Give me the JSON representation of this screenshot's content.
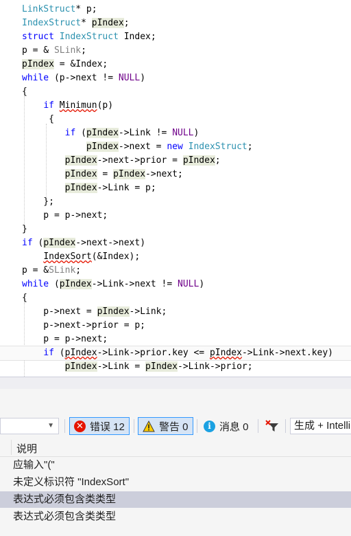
{
  "editor": {
    "lines": [
      [
        [
          "LinkStruct",
          "type"
        ],
        [
          "* p;",
          ""
        ]
      ],
      [
        [
          "IndexStruct",
          "type"
        ],
        [
          "* ",
          ""
        ],
        [
          "pIndex",
          "hl"
        ],
        [
          ";",
          ""
        ]
      ],
      [
        [
          "struct ",
          "kw"
        ],
        [
          "IndexStruct",
          "type"
        ],
        [
          " Index;",
          ""
        ]
      ],
      [
        [
          "p = & ",
          ""
        ],
        [
          "SLink",
          "dim"
        ],
        [
          ";",
          ""
        ]
      ],
      [
        [
          "pIndex",
          "hl"
        ],
        [
          " = &Index;",
          ""
        ]
      ],
      [
        [
          "while",
          "kw"
        ],
        [
          " (p->next != ",
          ""
        ],
        [
          "NULL",
          "macro"
        ],
        [
          ")",
          ""
        ]
      ],
      [
        [
          "{",
          ""
        ]
      ],
      [
        [
          "    ",
          ""
        ],
        [
          "if",
          "kw"
        ],
        [
          " ",
          ""
        ],
        [
          "Minimun",
          "err"
        ],
        [
          "(p)",
          ""
        ]
      ],
      [
        [
          "     {",
          ""
        ]
      ],
      [
        [
          "        ",
          ""
        ],
        [
          "if",
          "kw"
        ],
        [
          " (",
          ""
        ],
        [
          "pIndex",
          "hl"
        ],
        [
          "->Link != ",
          ""
        ],
        [
          "NULL",
          "macro"
        ],
        [
          ")",
          ""
        ]
      ],
      [
        [
          "            ",
          ""
        ],
        [
          "pIndex",
          "hl"
        ],
        [
          "->next = ",
          ""
        ],
        [
          "new",
          "kw"
        ],
        [
          " ",
          ""
        ],
        [
          "IndexStruct",
          "type"
        ],
        [
          ";",
          ""
        ]
      ],
      [
        [
          "        ",
          ""
        ],
        [
          "pIndex",
          "hl"
        ],
        [
          "->next->prior = ",
          ""
        ],
        [
          "pIndex",
          "hl"
        ],
        [
          ";",
          ""
        ]
      ],
      [
        [
          "        ",
          ""
        ],
        [
          "pIndex",
          "hl"
        ],
        [
          " = ",
          ""
        ],
        [
          "pIndex",
          "hl"
        ],
        [
          "->next;",
          ""
        ]
      ],
      [
        [
          "        ",
          ""
        ],
        [
          "pIndex",
          "hl"
        ],
        [
          "->Link = p;",
          ""
        ]
      ],
      [
        [
          "    };",
          ""
        ]
      ],
      [
        [
          "    p = p->next;",
          ""
        ]
      ],
      [
        [
          "}",
          ""
        ]
      ],
      [
        [
          "if",
          "kw"
        ],
        [
          " (",
          ""
        ],
        [
          "pIndex",
          "hl"
        ],
        [
          "->next->next)",
          ""
        ]
      ],
      [
        [
          "    ",
          ""
        ],
        [
          "IndexSort",
          "err"
        ],
        [
          "(&Index);",
          ""
        ]
      ],
      [
        [
          "p = &",
          ""
        ],
        [
          "SLink",
          "dim"
        ],
        [
          ";",
          ""
        ]
      ],
      [
        [
          "while",
          "kw"
        ],
        [
          " (",
          ""
        ],
        [
          "pIndex",
          "hl"
        ],
        [
          "->Link->next != ",
          ""
        ],
        [
          "NULL",
          "macro"
        ],
        [
          ")",
          ""
        ]
      ],
      [
        [
          "{",
          ""
        ]
      ],
      [
        [
          "    p->next = ",
          ""
        ],
        [
          "pIndex",
          "hl"
        ],
        [
          "->Link;",
          ""
        ]
      ],
      [
        [
          "    p->next->prior = p;",
          ""
        ]
      ],
      [
        [
          "    p = p->next;",
          ""
        ]
      ],
      [
        [
          "    ",
          ""
        ],
        [
          "if",
          "kw"
        ],
        [
          " (",
          ""
        ],
        [
          "pIndex",
          "err"
        ],
        [
          "->Link->prior.key <= ",
          ""
        ],
        [
          "pIndex",
          "err"
        ],
        [
          "->Link->next.key)",
          ""
        ]
      ],
      [
        [
          "        ",
          ""
        ],
        [
          "pIndex",
          "hl"
        ],
        [
          "->Link = ",
          ""
        ],
        [
          "pIndex",
          "hl"
        ],
        [
          "->Link->prior;",
          ""
        ]
      ]
    ],
    "current_line": 25
  },
  "error_list": {
    "error_label": "错误 12",
    "warning_label": "警告 0",
    "message_label": "消息 0",
    "build_filter": "生成 + IntelliSense",
    "column_header": "说明",
    "rows": [
      "应输入\"(\"",
      "未定义标识符 \"IndexSort\"",
      "表达式必须包含类类型",
      "表达式必须包含类类型"
    ],
    "selected_row": 2
  },
  "colors": {
    "keyword": "#0000ff",
    "type": "#2b91af",
    "macro": "#6f008a",
    "error_squiggle": "#e51400",
    "identifier_highlight": "#e8ecdc",
    "selected_row": "#cccedb"
  }
}
